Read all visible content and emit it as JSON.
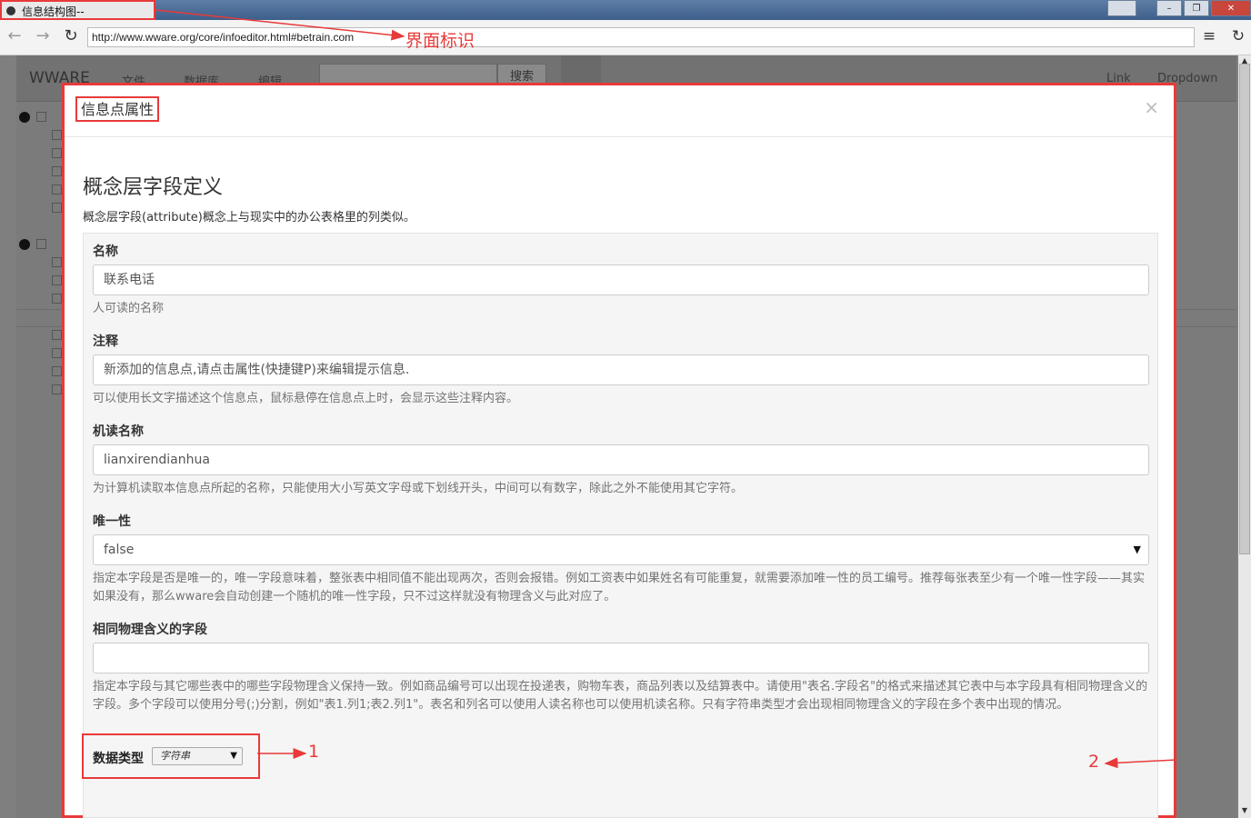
{
  "browser": {
    "tab_title": "信息结构图--betrain.com",
    "url": "http://www.wware.org/core/infoeditor.html#betrain.com",
    "back_glyph": "←",
    "forward_glyph": "→",
    "reload_glyph": "↻",
    "menu_glyph": "≡",
    "win_minimize": "–",
    "win_restore": "❐",
    "win_close": "✕"
  },
  "annotations": {
    "interface_label": "界面标识",
    "marker_1": "1",
    "marker_2": "2",
    "color": "#e83a3a"
  },
  "background_app": {
    "brand": "WWARE",
    "menus": [
      "文件",
      "数据库",
      "编辑"
    ],
    "search_button": "搜索",
    "link": "Link",
    "dropdown": "Dropdown"
  },
  "modal": {
    "title": "信息点属性",
    "close_glyph": "×",
    "section_title": "概念层字段定义",
    "section_desc": "概念层字段(attribute)概念上与现实中的办公表格里的列类似。",
    "fields": {
      "name": {
        "label": "名称",
        "value": "联系电话",
        "help": "人可读的名称"
      },
      "comment": {
        "label": "注释",
        "value": "新添加的信息点,请点击属性(快捷键P)来编辑提示信息.",
        "help": "可以使用长文字描述这个信息点，鼠标悬停在信息点上时，会显示这些注释内容。"
      },
      "machine_name": {
        "label": "机读名称",
        "value": "lianxirendianhua",
        "help": "为计算机读取本信息点所起的名称，只能使用大小写英文字母或下划线开头，中间可以有数字，除此之外不能使用其它字符。"
      },
      "unique": {
        "label": "唯一性",
        "value": "false",
        "help": "指定本字段是否是唯一的，唯一字段意味着，整张表中相同值不能出现两次，否则会报错。例如工资表中如果姓名有可能重复，就需要添加唯一性的员工编号。推荐每张表至少有一个唯一性字段——其实如果没有，那么wware会自动创建一个随机的唯一性字段，只不过这样就没有物理含义与此对应了。"
      },
      "same_physical": {
        "label": "相同物理含义的字段",
        "value": "",
        "help": "指定本字段与其它哪些表中的哪些字段物理含义保持一致。例如商品编号可以出现在投递表，购物车表，商品列表以及结算表中。请使用\"表名.字段名\"的格式来描述其它表中与本字段具有相同物理含义的字段。多个字段可以使用分号(;)分割，例如\"表1.列1;表2.列1\"。表名和列名可以使用人读名称也可以使用机读名称。只有字符串类型才会出现相同物理含义的字段在多个表中出现的情况。"
      },
      "data_type": {
        "label": "数据类型",
        "value": "字符串"
      }
    }
  }
}
